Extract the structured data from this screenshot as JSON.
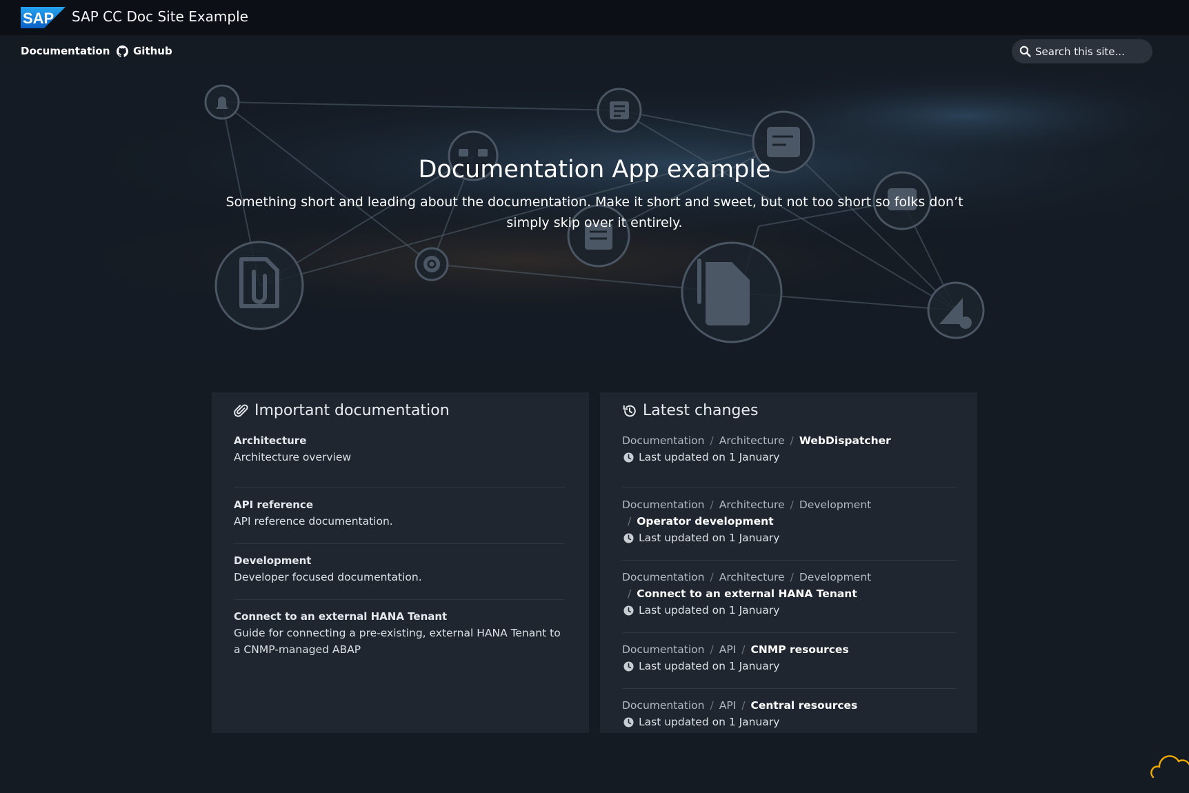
{
  "header": {
    "logo_text": "SAP",
    "site_title": "SAP CC Doc Site Example"
  },
  "nav": {
    "documentation": "Documentation",
    "github": "Github",
    "search_placeholder": "Search this site..."
  },
  "hero": {
    "title": "Documentation App example",
    "subtitle": "Something short and leading about the documentation. Make it short and sweet, but not too short so folks don’t simply skip over it entirely."
  },
  "important": {
    "title": "Important documentation",
    "items": [
      {
        "name": "Architecture",
        "desc": "Architecture overview"
      },
      {
        "name": "API reference",
        "desc": "API reference documentation."
      },
      {
        "name": "Development",
        "desc": "Developer focused documentation."
      },
      {
        "name": "Connect to an external HANA Tenant",
        "desc": "Guide for connecting a pre-existing, external HANA Tenant to a CNMP-managed ABAP"
      }
    ]
  },
  "latest": {
    "title": "Latest changes",
    "items": [
      {
        "crumbs": [
          "Documentation",
          "Architecture"
        ],
        "current": "WebDispatcher",
        "updated": "Last updated on 1 January"
      },
      {
        "crumbs": [
          "Documentation",
          "Architecture",
          "Development"
        ],
        "current": "Operator development",
        "updated": "Last updated on 1 January"
      },
      {
        "crumbs": [
          "Documentation",
          "Architecture",
          "Development"
        ],
        "current": "Connect to an external HANA Tenant",
        "updated": "Last updated on 1 January"
      },
      {
        "crumbs": [
          "Documentation",
          "API"
        ],
        "current": "CNMP resources",
        "updated": "Last updated on 1 January"
      },
      {
        "crumbs": [
          "Documentation",
          "API"
        ],
        "current": "Central resources",
        "updated": "Last updated on 1 January"
      }
    ]
  },
  "colors": {
    "topbar": "#0c1016",
    "background": "#151b23",
    "card": "#1f2630",
    "sap_blue": "#1a73d1",
    "cloud_accent": "#f0ab00"
  }
}
